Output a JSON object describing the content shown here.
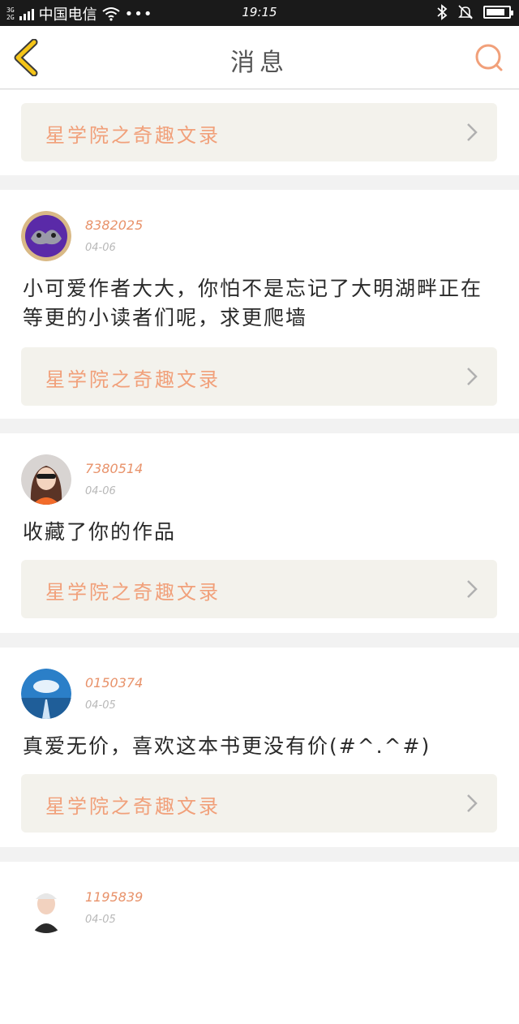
{
  "status_bar": {
    "network_label": "3G\n2G",
    "carrier": "中国电信",
    "dots": "•••",
    "time": "19:15",
    "battery_level": 0.85
  },
  "header": {
    "title": "消息",
    "back_icon": "chevron-left-icon",
    "search_icon": "search-icon"
  },
  "colors": {
    "accent": "#f1a07a",
    "back_icon": "#f5c518",
    "card_bg": "#f3f2ec"
  },
  "messages": [
    {
      "user": "",
      "date": "",
      "text": "",
      "book": "星学院之奇趣文录"
    },
    {
      "user": "8382025",
      "date": "04-06",
      "text": "小可爱作者大大，你怕不是忘记了大明湖畔正在等更的小读者们呢，求更爬墙",
      "book": "星学院之奇趣文录"
    },
    {
      "user": "7380514",
      "date": "04-06",
      "text": "收藏了你的作品",
      "book": "星学院之奇趣文录"
    },
    {
      "user": "0150374",
      "date": "04-05",
      "text": "真爱无价，喜欢这本书更没有价(#^.^#)",
      "book": "星学院之奇趣文录"
    },
    {
      "user": "1195839",
      "date": "04-05",
      "text": "",
      "book": ""
    }
  ]
}
